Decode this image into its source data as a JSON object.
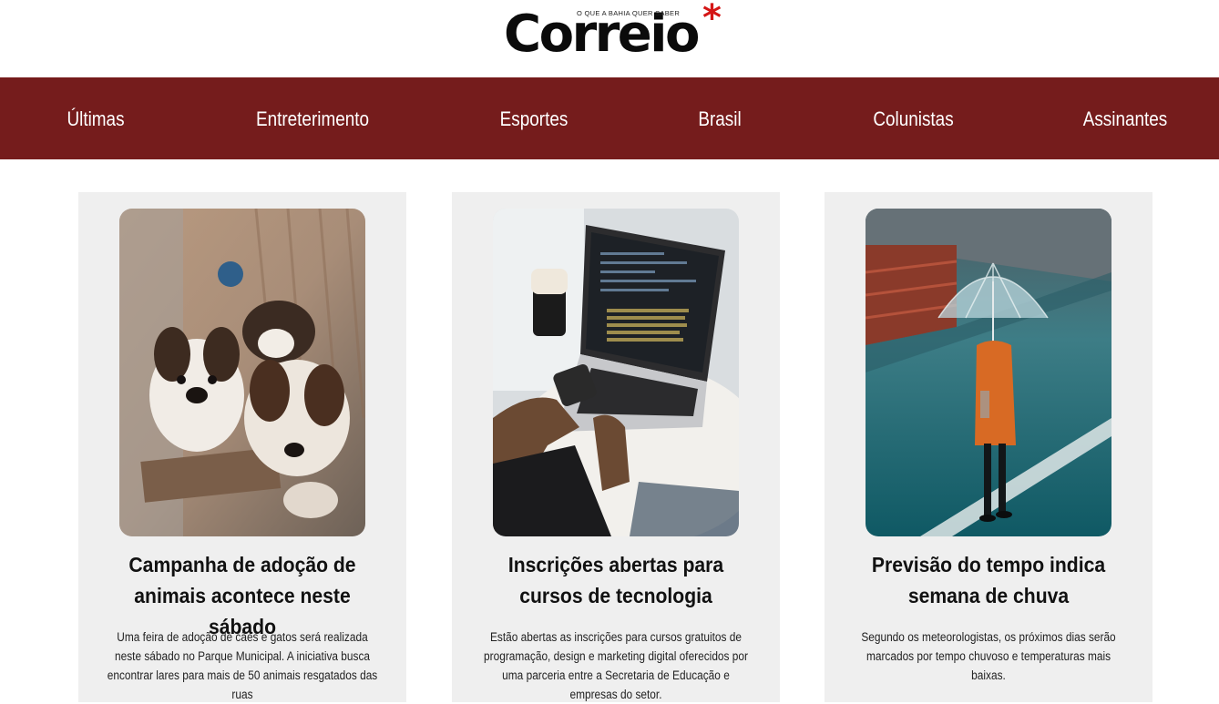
{
  "brand": {
    "name": "Correio",
    "tagline": "O QUE A BAHIA QUER SABER",
    "star": "*",
    "colors": {
      "nav_bg": "#751c1c",
      "star": "#d41616",
      "card_bg": "#efefef"
    }
  },
  "nav": {
    "items": [
      {
        "label": "Últimas"
      },
      {
        "label": "Entreterimento"
      },
      {
        "label": "Esportes"
      },
      {
        "label": "Brasil"
      },
      {
        "label": "Colunistas"
      },
      {
        "label": "Assinantes"
      }
    ]
  },
  "cards": [
    {
      "image": "puppies-photo",
      "title": "Campanha de adoção de animais acontece neste sábado",
      "description": "Uma feira de adoção de cães e gatos será realizada neste sábado no Parque Municipal. A iniciativa busca encontrar lares para mais de 50 animais resgatados das ruas"
    },
    {
      "image": "laptop-coding-photo",
      "title": "Inscrições abertas para cursos de tecnologia",
      "description": "Estão abertas as inscrições para cursos gratuitos de programação, design e marketing digital oferecidos por uma parceria entre a Secretaria de Educação e empresas do setor."
    },
    {
      "image": "rain-umbrella-photo",
      "title": "Previsão do tempo indica semana de chuva",
      "description": "Segundo os meteorologistas, os próximos dias serão marcados por tempo chuvoso e temperaturas mais baixas."
    }
  ]
}
